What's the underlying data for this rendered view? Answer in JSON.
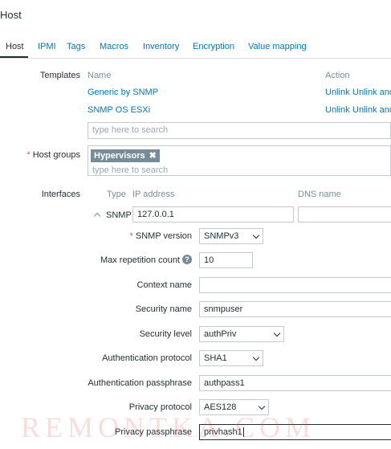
{
  "page": {
    "title": "Host"
  },
  "tabs": [
    {
      "label": "Host"
    },
    {
      "label": "IPMI"
    },
    {
      "label": "Tags"
    },
    {
      "label": "Macros"
    },
    {
      "label": "Inventory"
    },
    {
      "label": "Encryption"
    },
    {
      "label": "Value mapping"
    }
  ],
  "templates": {
    "label": "Templates",
    "col_name": "Name",
    "col_action": "Action",
    "items": [
      {
        "name": "Generic by SNMP",
        "unlink": "Unlink",
        "unlink_clear": "Unlink and"
      },
      {
        "name": "SNMP OS ESXi",
        "unlink": "Unlink",
        "unlink_clear": "Unlink and"
      }
    ],
    "search_placeholder": "type here to search"
  },
  "host_groups": {
    "required_mark": "*",
    "label": "Host groups",
    "chip": "Hypervisors",
    "chip_remove": "✖",
    "search_placeholder": "type here to search"
  },
  "interfaces": {
    "label": "Interfaces",
    "col_type": "Type",
    "col_ip": "IP address",
    "col_dns": "DNS name",
    "row": {
      "type": "SNMP",
      "ip": "127.0.0.1",
      "dns": ""
    }
  },
  "snmp": {
    "version_required": "*",
    "version_label": "SNMP version",
    "version_value": "SNMPv3",
    "max_rep_label": "Max repetition count",
    "max_rep_help": "?",
    "max_rep_value": "10",
    "context_label": "Context name",
    "context_value": "",
    "security_name_label": "Security name",
    "security_name_value": "snmpuser",
    "security_level_label": "Security level",
    "security_level_value": "authPriv",
    "auth_protocol_label": "Authentication protocol",
    "auth_protocol_value": "SHA1",
    "auth_pass_label": "Authentication passphrase",
    "auth_pass_value": "authpass1",
    "priv_protocol_label": "Privacy protocol",
    "priv_protocol_value": "AES128",
    "priv_pass_label": "Privacy passphrase",
    "priv_pass_value": "privhash1"
  },
  "watermark": "REMONTKA.COM",
  "colors": {
    "link": "#0275b8",
    "text": "#1f2c33",
    "muted": "#768d99",
    "required": "#e45959",
    "border": "#c4c9cc"
  }
}
